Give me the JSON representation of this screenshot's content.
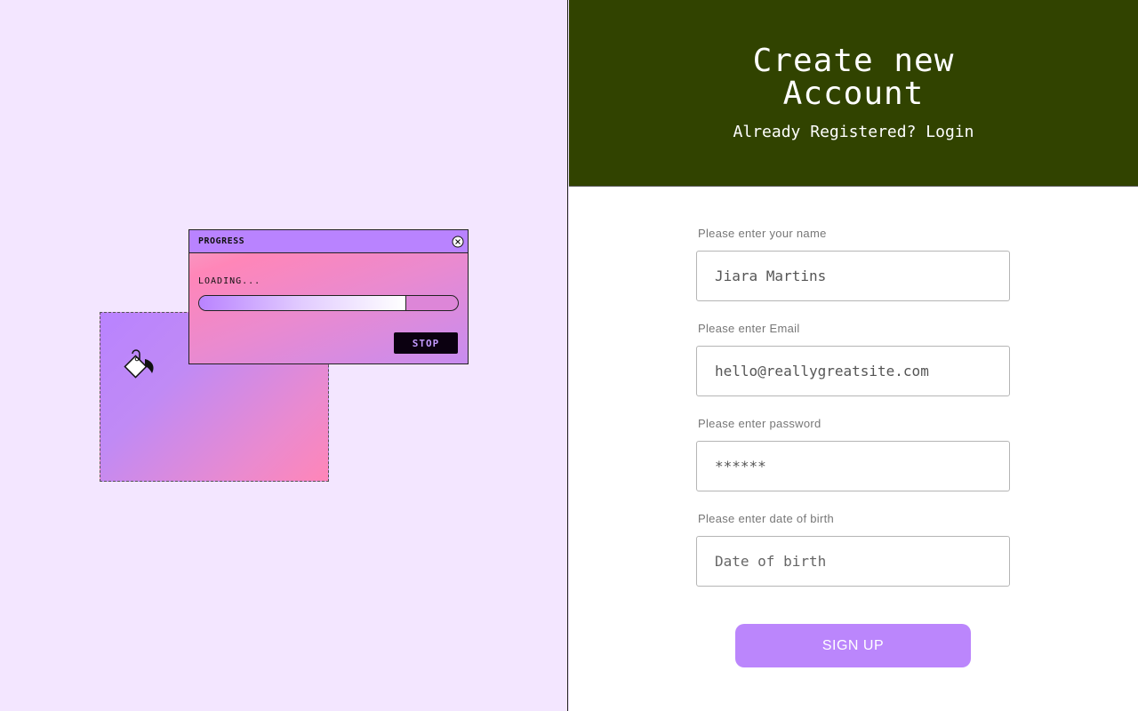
{
  "progress_window": {
    "title": "PROGRESS",
    "loading_label": "LOADING...",
    "progress_fraction": 0.8,
    "stop_label": "STOP"
  },
  "icons": {
    "close": "close-circle-icon",
    "paint_bucket": "paint-bucket-icon"
  },
  "signup": {
    "title_line1": "Create new",
    "title_line2": "Account",
    "already_text": "Already Registered?",
    "login_link": "Login",
    "fields": [
      {
        "label": "Please enter your name",
        "value": "Jiara Martins",
        "placeholder": ""
      },
      {
        "label": "Please enter Email",
        "value": "hello@reallygreatsite.com",
        "placeholder": ""
      },
      {
        "label": "Please enter password",
        "value": "******",
        "placeholder": ""
      },
      {
        "label": "Please enter date of birth",
        "value": "",
        "placeholder": "Date of birth"
      }
    ],
    "submit_label": "SIGN UP"
  },
  "colors": {
    "left_bg": "#f3e6ff",
    "header_bg": "#314300",
    "accent_purple": "#bb86fc",
    "accent_pink": "#ff86b8"
  }
}
